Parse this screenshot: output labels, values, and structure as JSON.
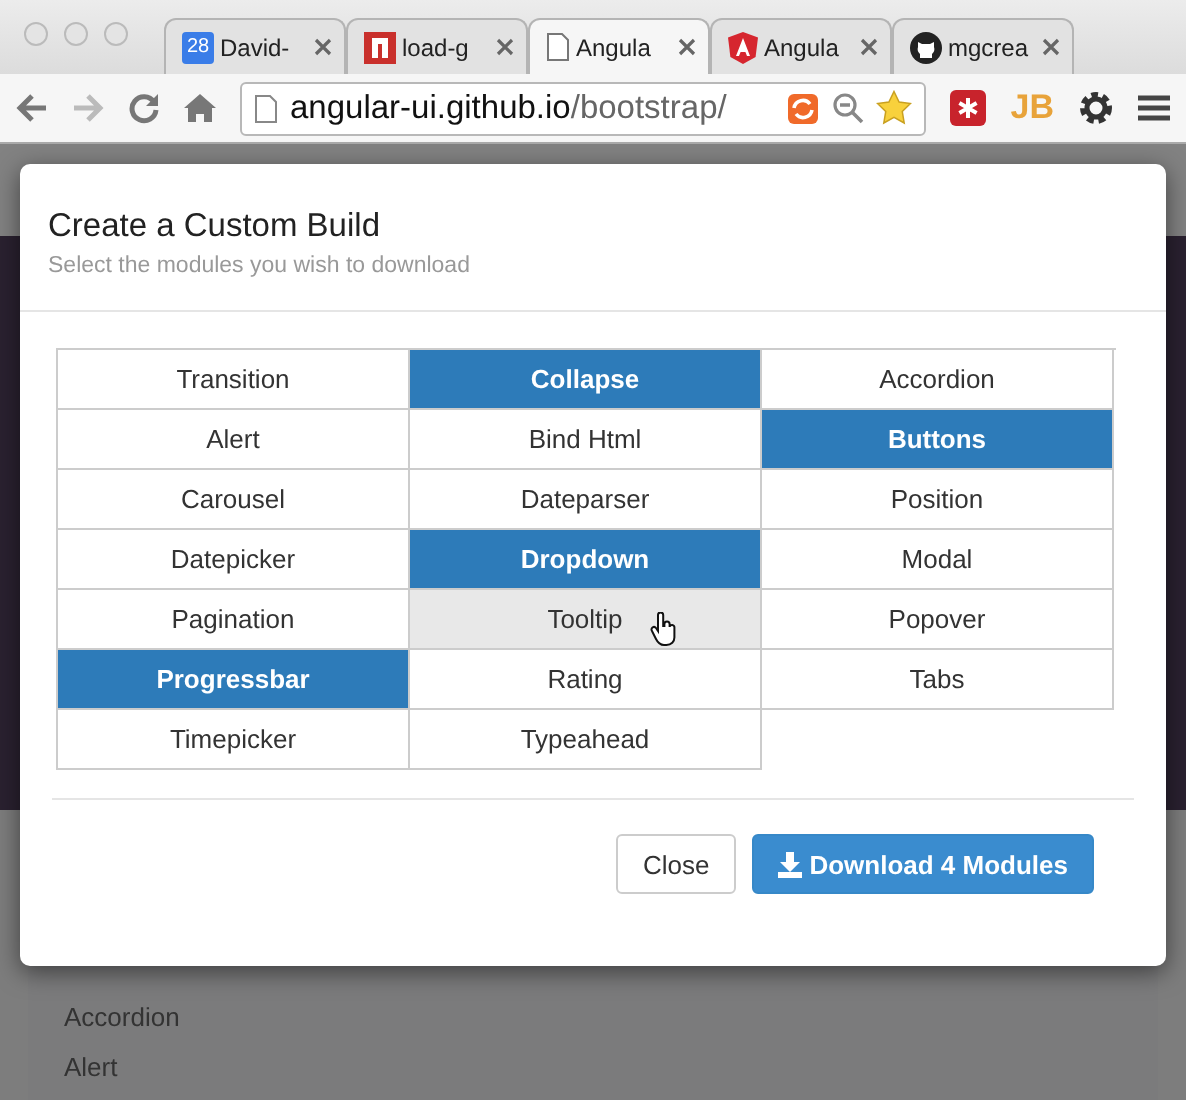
{
  "browser": {
    "tabs": [
      {
        "title": "David-",
        "kind": "calendar",
        "icon_text": "28",
        "selected": false
      },
      {
        "title": "load-g",
        "kind": "red",
        "selected": false
      },
      {
        "title": "Angula",
        "kind": "page",
        "selected": true
      },
      {
        "title": "Angula",
        "kind": "angular",
        "selected": false
      },
      {
        "title": "mgcrea",
        "kind": "github",
        "selected": false
      }
    ],
    "address": {
      "host": "angular-ui.github.io",
      "path": "/bootstrap/"
    },
    "extensions": [
      {
        "kind": "red"
      },
      {
        "kind": "jb",
        "text": "JB"
      },
      {
        "kind": "gear"
      },
      {
        "kind": "menu"
      }
    ]
  },
  "modal": {
    "title": "Create a Custom Build",
    "subtitle": "Select the modules you wish to download",
    "modules": [
      {
        "label": "Transition",
        "selected": false,
        "hovered": false
      },
      {
        "label": "Collapse",
        "selected": true,
        "hovered": false
      },
      {
        "label": "Accordion",
        "selected": false,
        "hovered": false
      },
      {
        "label": "Alert",
        "selected": false,
        "hovered": false
      },
      {
        "label": "Bind Html",
        "selected": false,
        "hovered": false
      },
      {
        "label": "Buttons",
        "selected": true,
        "hovered": false
      },
      {
        "label": "Carousel",
        "selected": false,
        "hovered": false
      },
      {
        "label": "Dateparser",
        "selected": false,
        "hovered": false
      },
      {
        "label": "Position",
        "selected": false,
        "hovered": false
      },
      {
        "label": "Datepicker",
        "selected": false,
        "hovered": false
      },
      {
        "label": "Dropdown",
        "selected": true,
        "hovered": false
      },
      {
        "label": "Modal",
        "selected": false,
        "hovered": false
      },
      {
        "label": "Pagination",
        "selected": false,
        "hovered": false
      },
      {
        "label": "Tooltip",
        "selected": false,
        "hovered": true
      },
      {
        "label": "Popover",
        "selected": false,
        "hovered": false
      },
      {
        "label": "Progressbar",
        "selected": true,
        "hovered": false
      },
      {
        "label": "Rating",
        "selected": false,
        "hovered": false
      },
      {
        "label": "Tabs",
        "selected": false,
        "hovered": false
      },
      {
        "label": "Timepicker",
        "selected": false,
        "hovered": false
      },
      {
        "label": "Typeahead",
        "selected": false,
        "hovered": false
      }
    ],
    "buttons": [
      {
        "label": "Close",
        "kind": "default"
      },
      {
        "label": "Download 4 Modules",
        "kind": "primary"
      }
    ]
  },
  "background_list": [
    "Accordion",
    "Alert"
  ]
}
